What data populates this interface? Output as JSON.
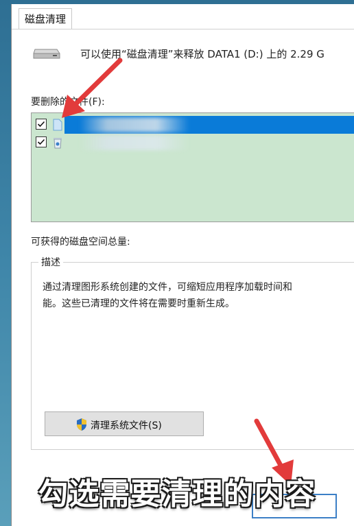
{
  "window": {
    "tab_label": "磁盘清理"
  },
  "header": {
    "summary_text": "可以使用“磁盘清理”来释放 DATA1 (D:) 上的 2.29 G"
  },
  "files_section": {
    "label": "要删除的文件(F):",
    "items": [
      {
        "checked": true,
        "selected": true,
        "icon": "file-icon"
      },
      {
        "checked": true,
        "selected": false,
        "icon": "recycle-bin-icon"
      }
    ]
  },
  "space_section": {
    "label": "可获得的磁盘空间总量:"
  },
  "description": {
    "legend": "描述",
    "text": "通过清理图形系统创建的文件，可缩短应用程序加载时间和\n能。这些已清理的文件将在需要时重新生成。"
  },
  "buttons": {
    "clean_system_files": "清理系统文件(S)"
  },
  "overlay": {
    "caption": "勾选需要清理的内容",
    "arrow_color": "#e23b3b"
  },
  "colors": {
    "list_background": "#cbe6cf",
    "selection": "#0a7bd8"
  }
}
